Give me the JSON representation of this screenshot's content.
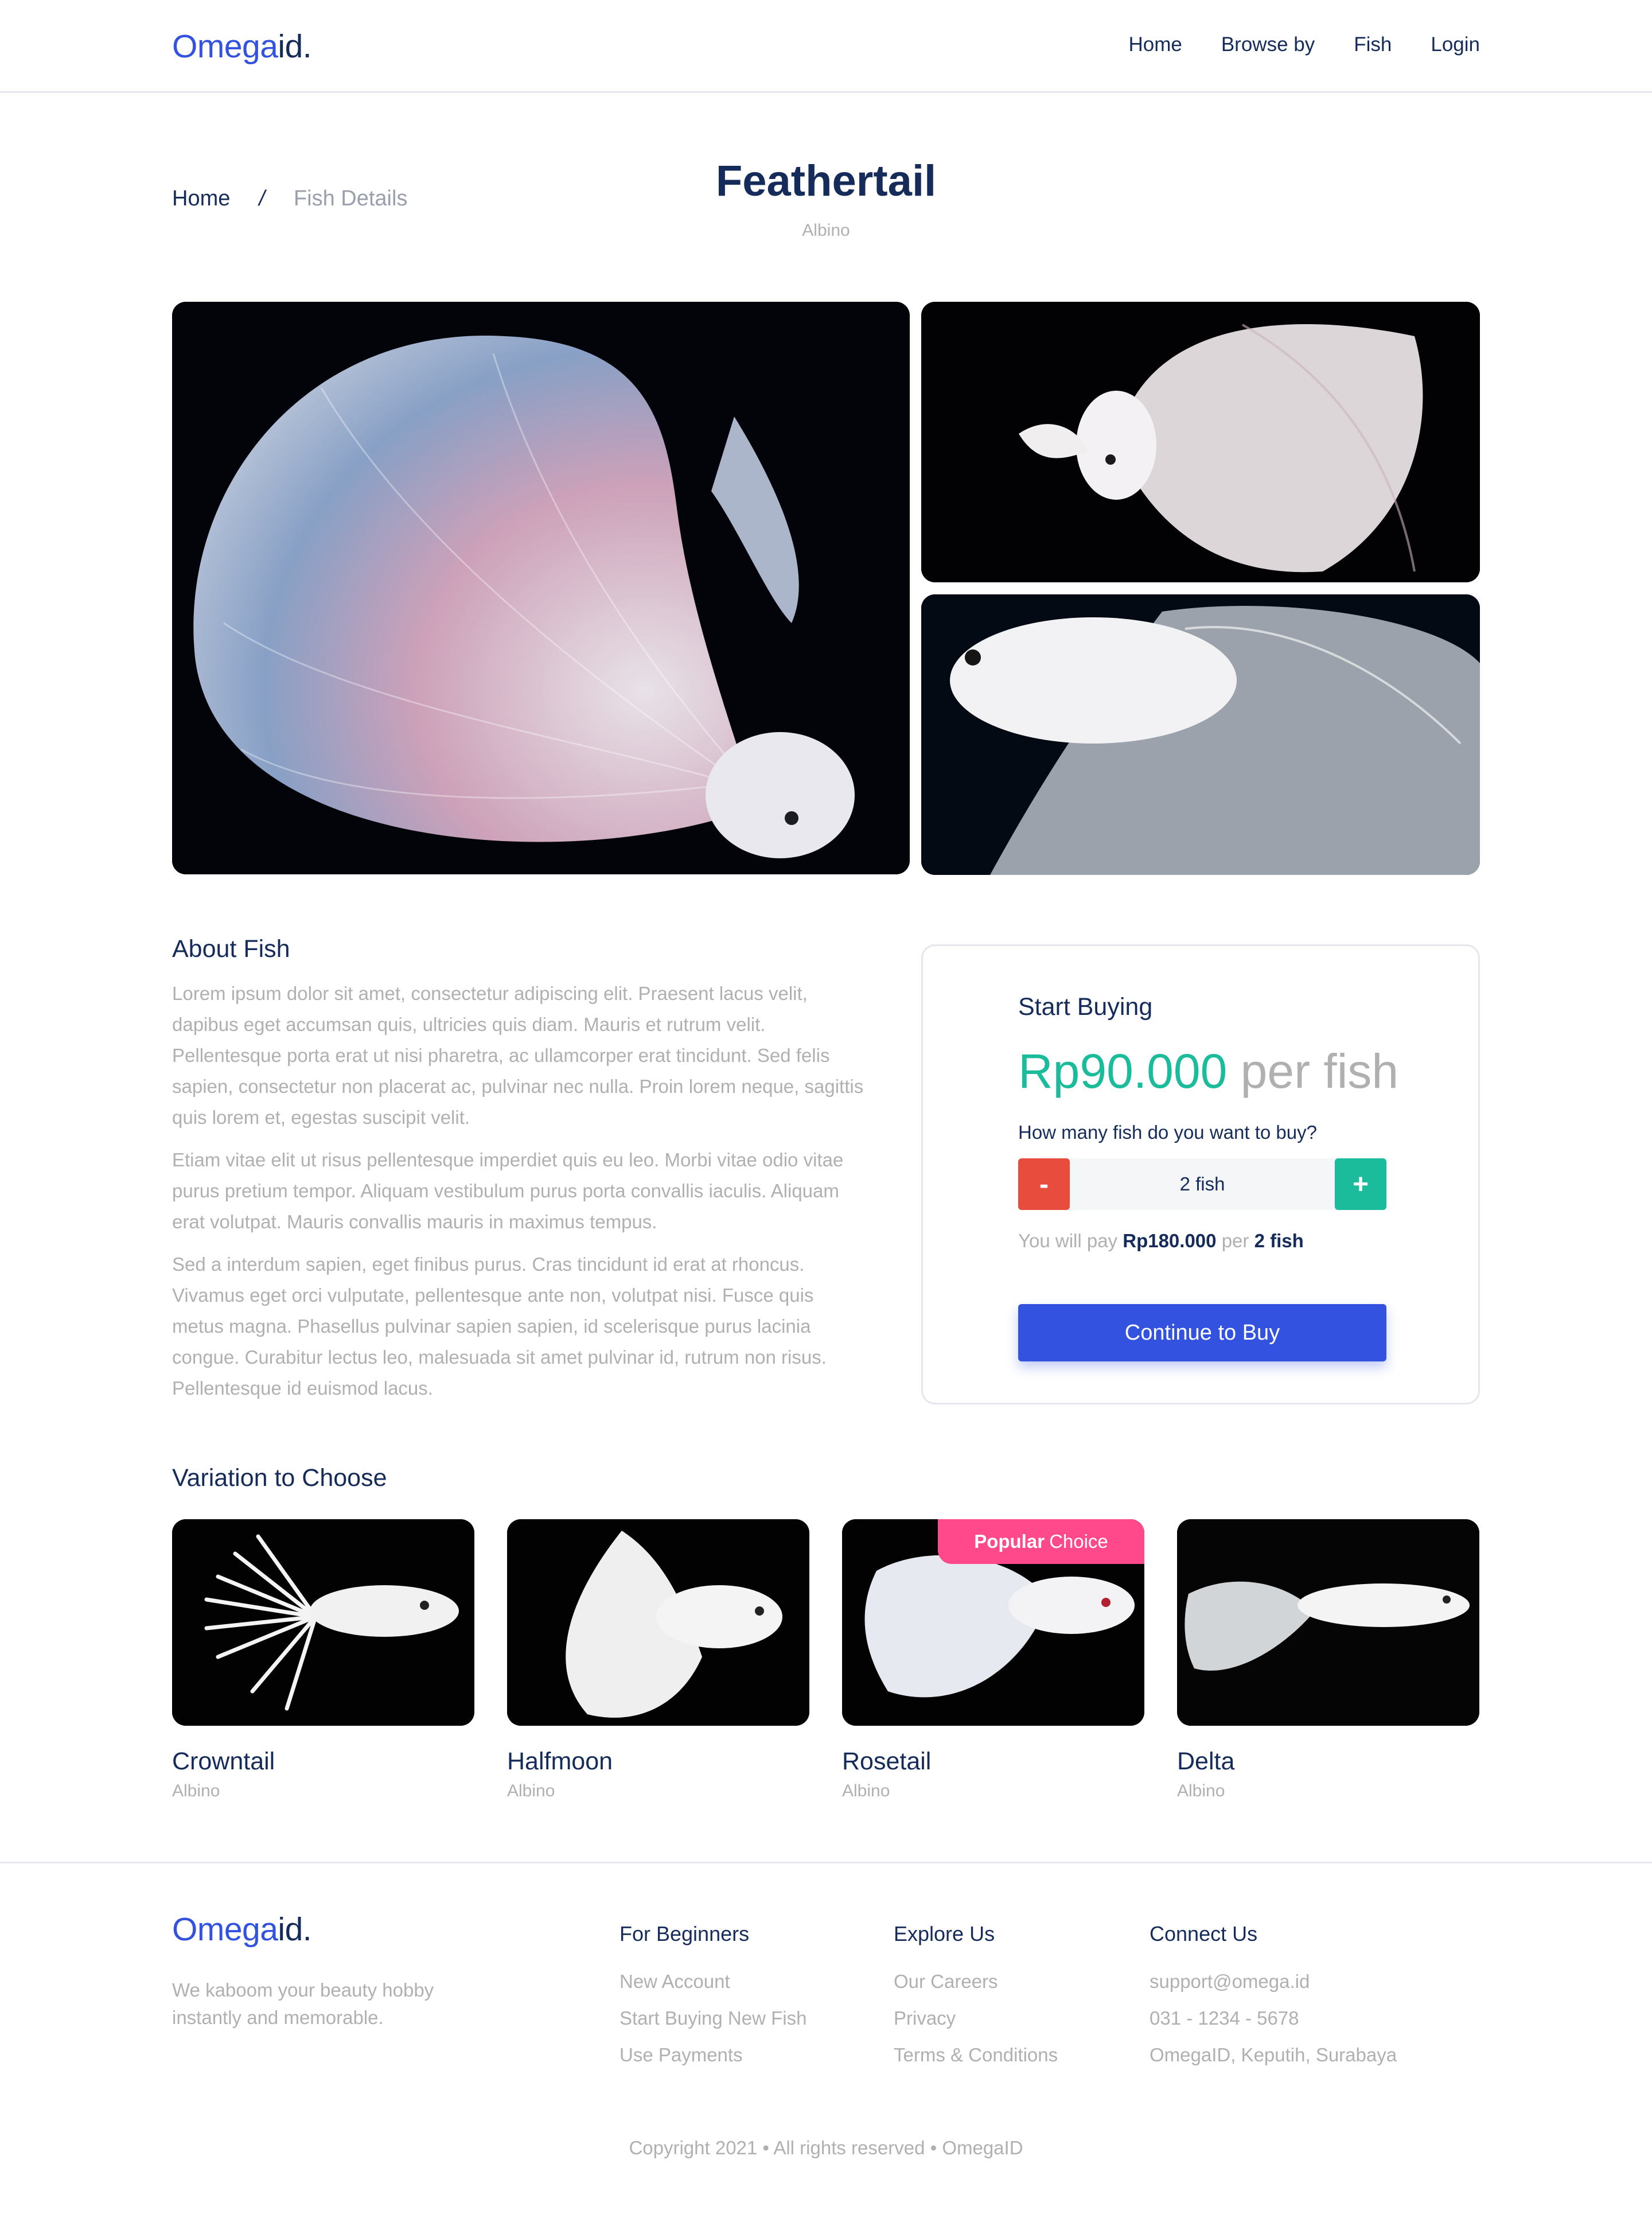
{
  "header": {
    "logo_part1": "Omega",
    "logo_part2": "id.",
    "nav": [
      "Home",
      "Browse by",
      "Fish",
      "Login"
    ]
  },
  "breadcrumb": {
    "home": "Home",
    "separator": "/",
    "current": "Fish Details"
  },
  "product": {
    "title": "Feathertail",
    "subtitle": "Albino"
  },
  "about": {
    "heading": "About Fish",
    "paragraphs": [
      "Lorem ipsum dolor sit amet, consectetur adipiscing elit. Praesent lacus velit, dapibus eget accumsan quis, ultricies quis diam. Mauris et rutrum velit. Pellentesque porta erat ut nisi pharetra, ac ullamcorper erat tincidunt. Sed felis sapien, consectetur non placerat ac, pulvinar nec nulla. Proin lorem neque, sagittis quis lorem et, egestas suscipit velit.",
      "Etiam vitae elit ut risus pellentesque imperdiet quis eu leo. Morbi vitae odio vitae purus pretium tempor. Aliquam vestibulum purus porta convallis iaculis. Aliquam erat volutpat. Mauris convallis mauris in maximus tempus.",
      "Sed a interdum sapien, eget finibus purus. Cras tincidunt id erat at rhoncus. Vivamus eget orci vulputate, pellentesque ante non, volutpat nisi. Fusce quis metus magna. Phasellus pulvinar sapien sapien, id scelerisque purus lacinia congue. Curabitur lectus leo, malesuada sit amet pulvinar id, rutrum non risus. Pellentesque id euismod lacus."
    ]
  },
  "buy": {
    "heading": "Start Buying",
    "price": "Rp90.000",
    "per": "per fish",
    "question": "How many fish do you want to buy?",
    "minus_label": "-",
    "plus_label": "+",
    "quantity": "2 fish",
    "pay_prefix": "You will pay",
    "pay_total": "Rp180.000",
    "pay_mid": "per",
    "pay_qty": "2 fish",
    "cta": "Continue to Buy"
  },
  "variations": {
    "heading": "Variation to Choose",
    "badge_bold": "Popular",
    "badge_rest": "Choice",
    "items": [
      {
        "name": "Crowntail",
        "type": "Albino"
      },
      {
        "name": "Halfmoon",
        "type": "Albino"
      },
      {
        "name": "Rosetail",
        "type": "Albino"
      },
      {
        "name": "Delta",
        "type": "Albino"
      }
    ]
  },
  "footer": {
    "logo_part1": "Omega",
    "logo_part2": "id.",
    "tagline": "We kaboom your beauty hobby instantly and memorable.",
    "columns": [
      {
        "title": "For Beginners",
        "links": [
          "New Account",
          "Start Buying New Fish",
          "Use Payments"
        ]
      },
      {
        "title": "Explore Us",
        "links": [
          "Our Careers",
          "Privacy",
          "Terms & Conditions"
        ]
      },
      {
        "title": "Connect Us",
        "links": [
          "support@omega.id",
          "031 - 1234 - 5678",
          "OmegaID, Keputih, Surabaya"
        ]
      }
    ],
    "copyright": "Copyright 2021 • All rights reserved • OmegaID"
  },
  "colors": {
    "primary": "#3252df",
    "navy": "#152c5b",
    "accent": "#1abc9c",
    "danger": "#e74c3c",
    "badge": "#ff498b",
    "muted": "#b0b0b0"
  }
}
